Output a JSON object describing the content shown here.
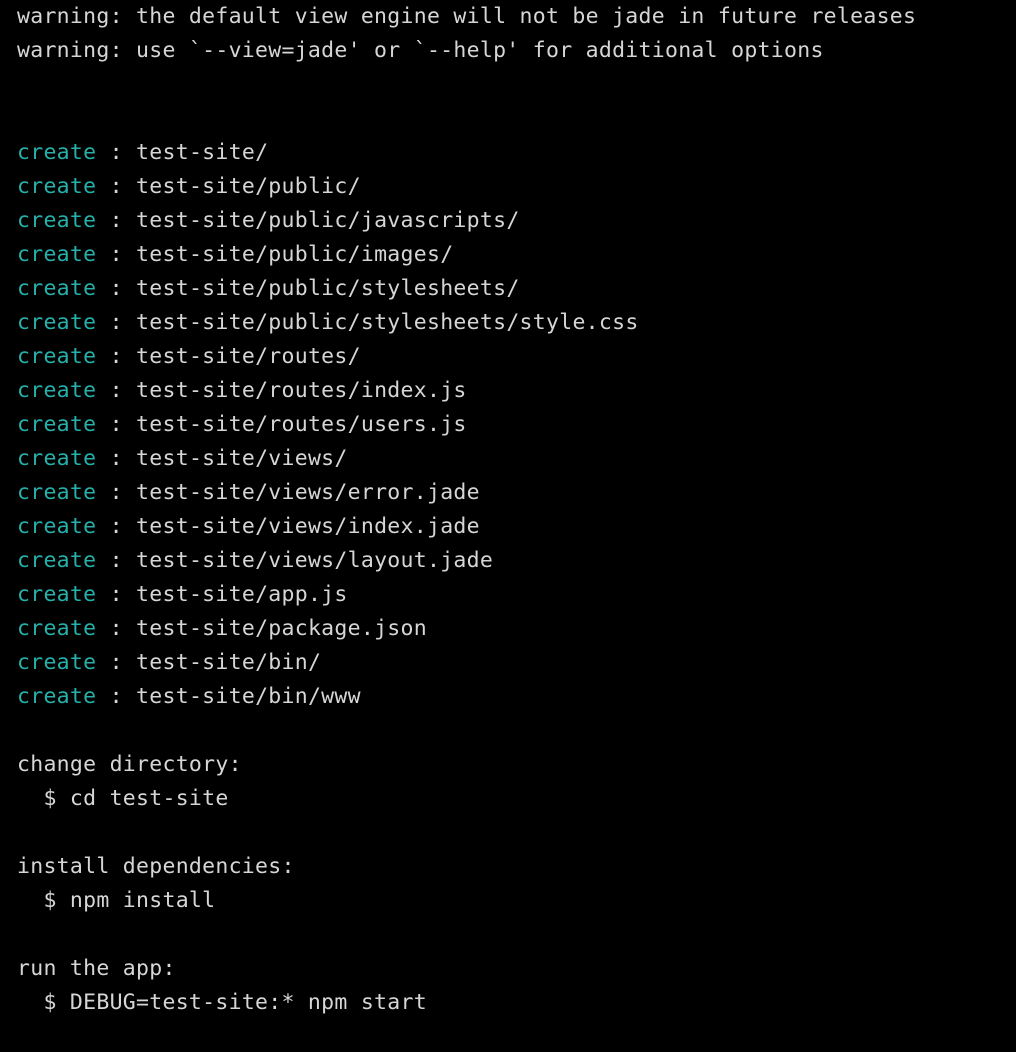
{
  "terminal": {
    "background_color": "#000000",
    "default_text_color": "#d6d6d6",
    "accent_color": "#26b0aa",
    "warnings": [
      "warning: the default view engine will not be jade in future releases",
      "warning: use `--view=jade' or `--help' for additional options"
    ],
    "create_label": "create",
    "create_separator": " : ",
    "created_paths": [
      "test-site/",
      "test-site/public/",
      "test-site/public/javascripts/",
      "test-site/public/images/",
      "test-site/public/stylesheets/",
      "test-site/public/stylesheets/style.css",
      "test-site/routes/",
      "test-site/routes/index.js",
      "test-site/routes/users.js",
      "test-site/views/",
      "test-site/views/error.jade",
      "test-site/views/index.jade",
      "test-site/views/layout.jade",
      "test-site/app.js",
      "test-site/package.json",
      "test-site/bin/",
      "test-site/bin/www"
    ],
    "instructions": [
      {
        "heading": "change directory:",
        "command": "$ cd test-site"
      },
      {
        "heading": "install dependencies:",
        "command": "$ npm install"
      },
      {
        "heading": "run the app:",
        "command": "$ DEBUG=test-site:* npm start"
      }
    ]
  }
}
